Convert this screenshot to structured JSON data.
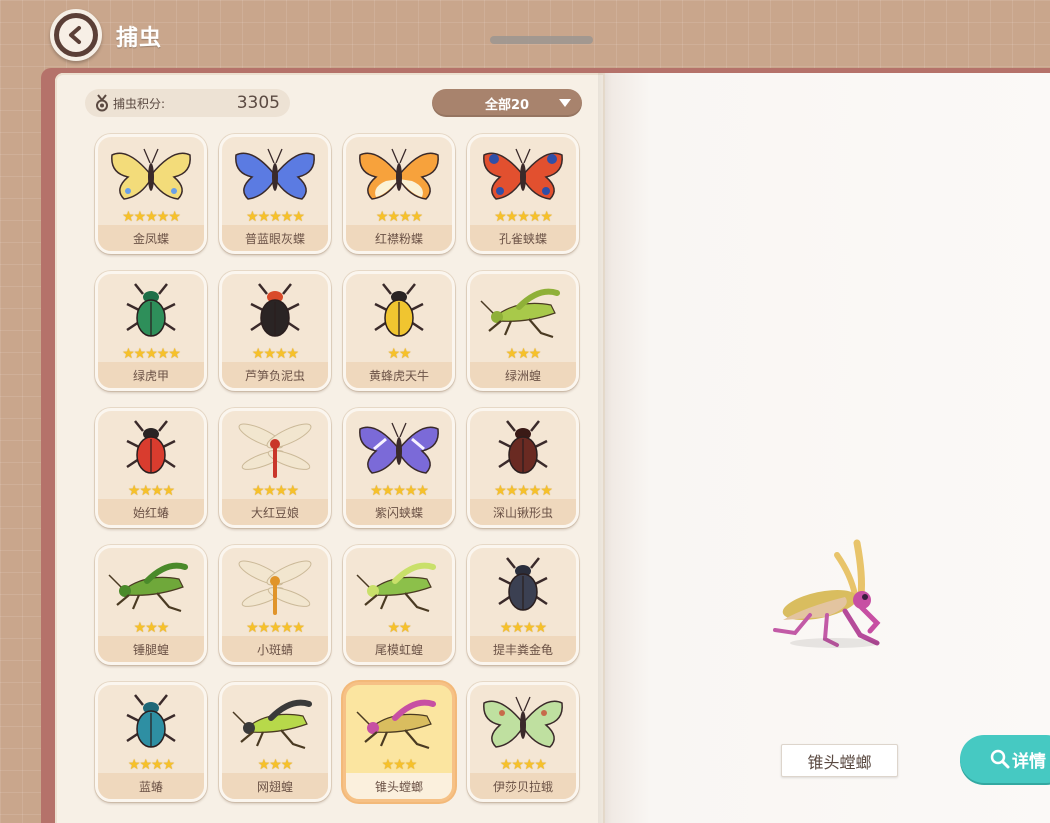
{
  "header": {
    "title": "捕虫"
  },
  "score": {
    "label": "捕虫积分:",
    "value": "3305"
  },
  "filter": {
    "label": "全部20"
  },
  "insects": [
    {
      "name": "金凤蝶",
      "stars": 5,
      "icon": "swallowtail-butterfly-icon"
    },
    {
      "name": "普蓝眼灰蝶",
      "stars": 5,
      "icon": "blue-butterfly-icon"
    },
    {
      "name": "红襟粉蝶",
      "stars": 4,
      "icon": "orange-tip-butterfly-icon"
    },
    {
      "name": "孔雀蛱蝶",
      "stars": 5,
      "icon": "peacock-butterfly-icon"
    },
    {
      "name": "绿虎甲",
      "stars": 5,
      "icon": "green-tiger-beetle-icon"
    },
    {
      "name": "芦笋负泥虫",
      "stars": 4,
      "icon": "asparagus-beetle-icon"
    },
    {
      "name": "黄蜂虎天牛",
      "stars": 2,
      "icon": "wasp-beetle-icon"
    },
    {
      "name": "绿洲蝗",
      "stars": 3,
      "icon": "green-grasshopper-icon"
    },
    {
      "name": "始红蝽",
      "stars": 4,
      "icon": "red-bug-icon"
    },
    {
      "name": "大红豆娘",
      "stars": 4,
      "icon": "red-damselfly-icon"
    },
    {
      "name": "紫闪蛱蝶",
      "stars": 5,
      "icon": "purple-emperor-butterfly-icon"
    },
    {
      "name": "深山锹形虫",
      "stars": 5,
      "icon": "stag-beetle-icon"
    },
    {
      "name": "锤腿蝗",
      "stars": 3,
      "icon": "club-leg-grasshopper-icon"
    },
    {
      "name": "小斑蜻",
      "stars": 5,
      "icon": "dragonfly-icon"
    },
    {
      "name": "尾模虹蝗",
      "stars": 2,
      "icon": "rainbow-grasshopper-icon"
    },
    {
      "name": "提丰粪金龟",
      "stars": 4,
      "icon": "dung-beetle-icon"
    },
    {
      "name": "蓝蝽",
      "stars": 4,
      "icon": "blue-shield-bug-icon"
    },
    {
      "name": "网翅蝗",
      "stars": 3,
      "icon": "net-wing-grasshopper-icon"
    },
    {
      "name": "锥头螳螂",
      "stars": 3,
      "icon": "cone-head-mantis-icon",
      "selected": true
    },
    {
      "name": "伊莎贝拉蛾",
      "stars": 4,
      "icon": "isabella-moth-icon"
    }
  ],
  "detail": {
    "name": "锥头螳螂",
    "button_label": "详情"
  },
  "colors": {
    "accent": "#46c9c2",
    "star": "#f6c12a",
    "cover": "#b5726a",
    "background": "#c9a68c"
  }
}
